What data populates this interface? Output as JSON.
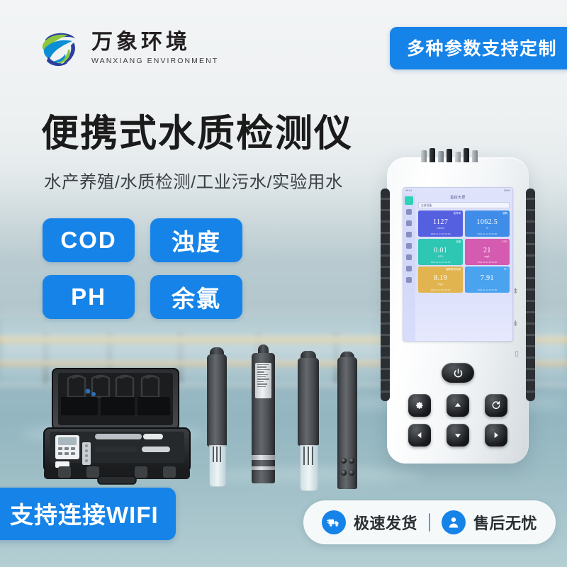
{
  "brand": {
    "logo_icon": "swirl-globe-logo-icon",
    "name_cn": "万象环境",
    "name_en": "WANXIANG ENVIRONMENT"
  },
  "badges": {
    "custom_params": "多种参数支持定制",
    "wifi": "支持连接WIFI"
  },
  "headline": {
    "title": "便携式水质检测仪",
    "subtitle": "水产养殖/水质检测/工业污水/实验用水"
  },
  "feature_tags": [
    {
      "label": "COD"
    },
    {
      "label": "浊度"
    },
    {
      "label": "PH"
    },
    {
      "label": "余氯"
    }
  ],
  "device": {
    "screen": {
      "status_left": "09:24",
      "status_right": "100%",
      "title": "监控大屏",
      "selector": "全部设备",
      "tiles": [
        {
          "name": "电导率",
          "value": "1127",
          "unit": "uS/cm",
          "time": "2024-11-14 15:24:06",
          "color": "#5560e0"
        },
        {
          "name": "溶氧",
          "value": "1062.5",
          "unit": "%",
          "time": "2024-11-14 15:24:06",
          "color": "#3f8de8"
        },
        {
          "name": "浊度",
          "value": "0.01",
          "unit": "NTU",
          "time": "2024-11-14 15:24:06",
          "color": "#2ec7b4"
        },
        {
          "name": "COD",
          "value": "21",
          "unit": "mg/L",
          "time": "2024-11-14 15:24:06",
          "color": "#d martial"
        },
        {
          "name": "溶解氧饱和度",
          "value": "8.19",
          "unit": "mg/L",
          "time": "2024-11-14 15:24:06",
          "color": "#e2b44f"
        },
        {
          "name": "PH",
          "value": "7.91",
          "unit": "",
          "time": "2024-11-14 15:24:06",
          "color": "#4aa3ef"
        }
      ]
    },
    "buttons": [
      {
        "icon": "power-icon",
        "name": "power-button"
      },
      {
        "icon": "gear-icon",
        "name": "settings-button"
      },
      {
        "icon": "up-arrow-icon",
        "name": "up-button"
      },
      {
        "icon": "refresh-icon",
        "name": "refresh-button"
      },
      {
        "icon": "left-arrow-icon",
        "name": "left-button"
      },
      {
        "icon": "down-arrow-icon",
        "name": "down-button"
      },
      {
        "icon": "right-arrow-icon",
        "name": "right-button"
      }
    ],
    "port_labels": [
      "usb-icon",
      "usb-icon",
      "port-icon"
    ]
  },
  "services": [
    {
      "icon": "delivery-truck-icon",
      "label": "极速发货"
    },
    {
      "icon": "support-agent-icon",
      "label": "售后无忧"
    }
  ],
  "colors": {
    "accent_blue": "#1683e8",
    "text_dark": "#1b1b1b"
  }
}
